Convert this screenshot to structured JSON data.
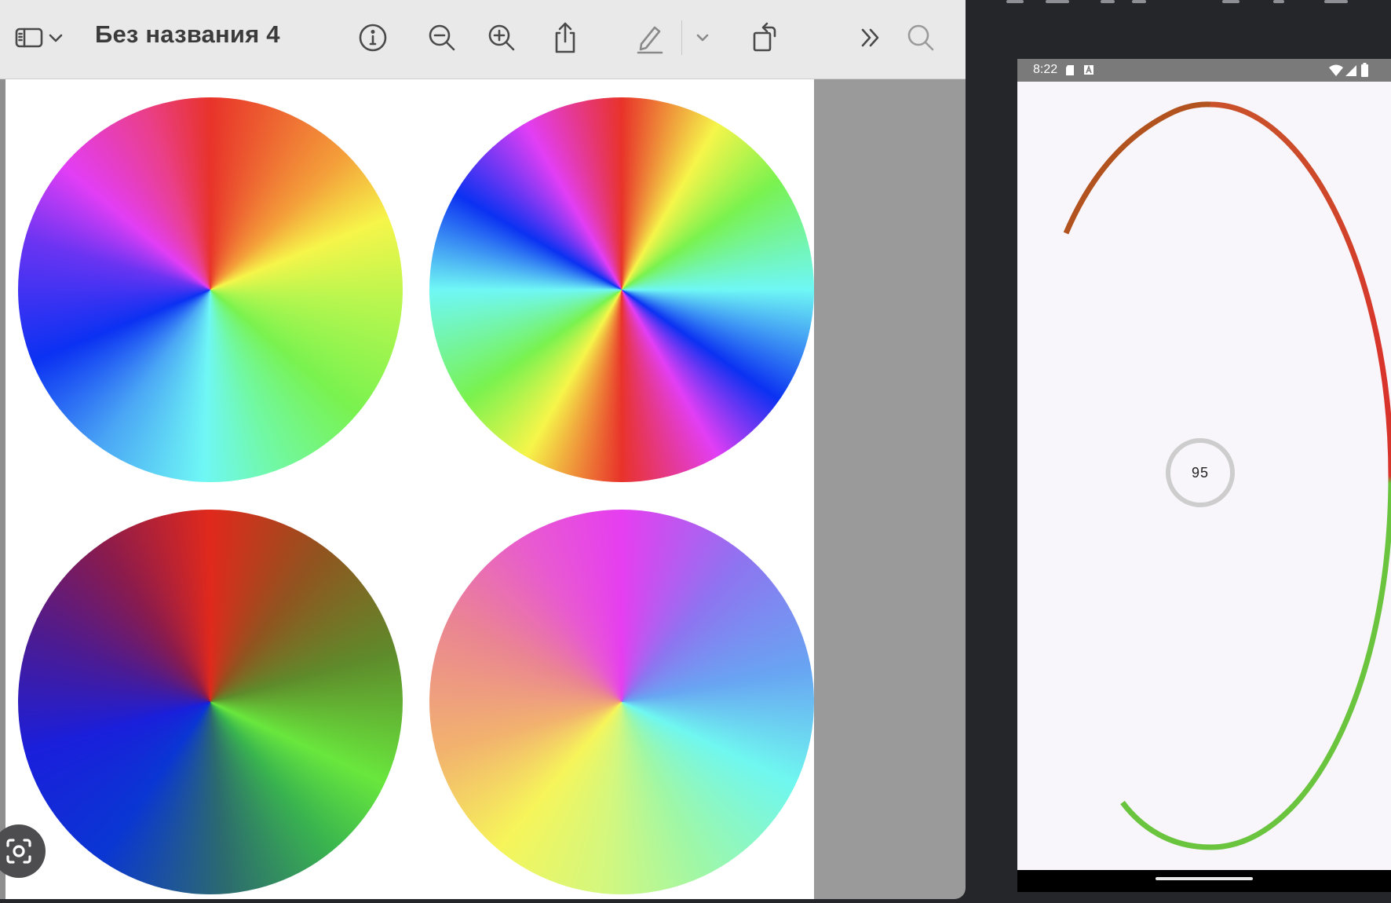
{
  "preview": {
    "title": "Без названия 4",
    "icons": [
      "sidebar-icon",
      "chevron-down-icon",
      "info-icon",
      "zoom-out-icon",
      "zoom-in-icon",
      "share-icon",
      "markup-pencil-icon",
      "markup-chevron-icon",
      "rotate-icon",
      "more-chevrons-icon",
      "search-icon"
    ],
    "wheels": [
      "conic-rgb-wheel",
      "conic-double-rgb-wheel",
      "conic-dark-rgb-wheel",
      "conic-pastel-wheel"
    ],
    "lens_icon": "camera-lens-icon"
  },
  "phone": {
    "status_time": "8:22",
    "status_icons": [
      "sd-card-icon",
      "a-icon",
      "wifi-icon",
      "signal-icon",
      "battery-icon"
    ],
    "progress_text": "95",
    "arc_colors": {
      "start": "#b2521f",
      "top": "#c9502a",
      "right": "#d9342b",
      "bottom": "#6ac43e"
    }
  }
}
